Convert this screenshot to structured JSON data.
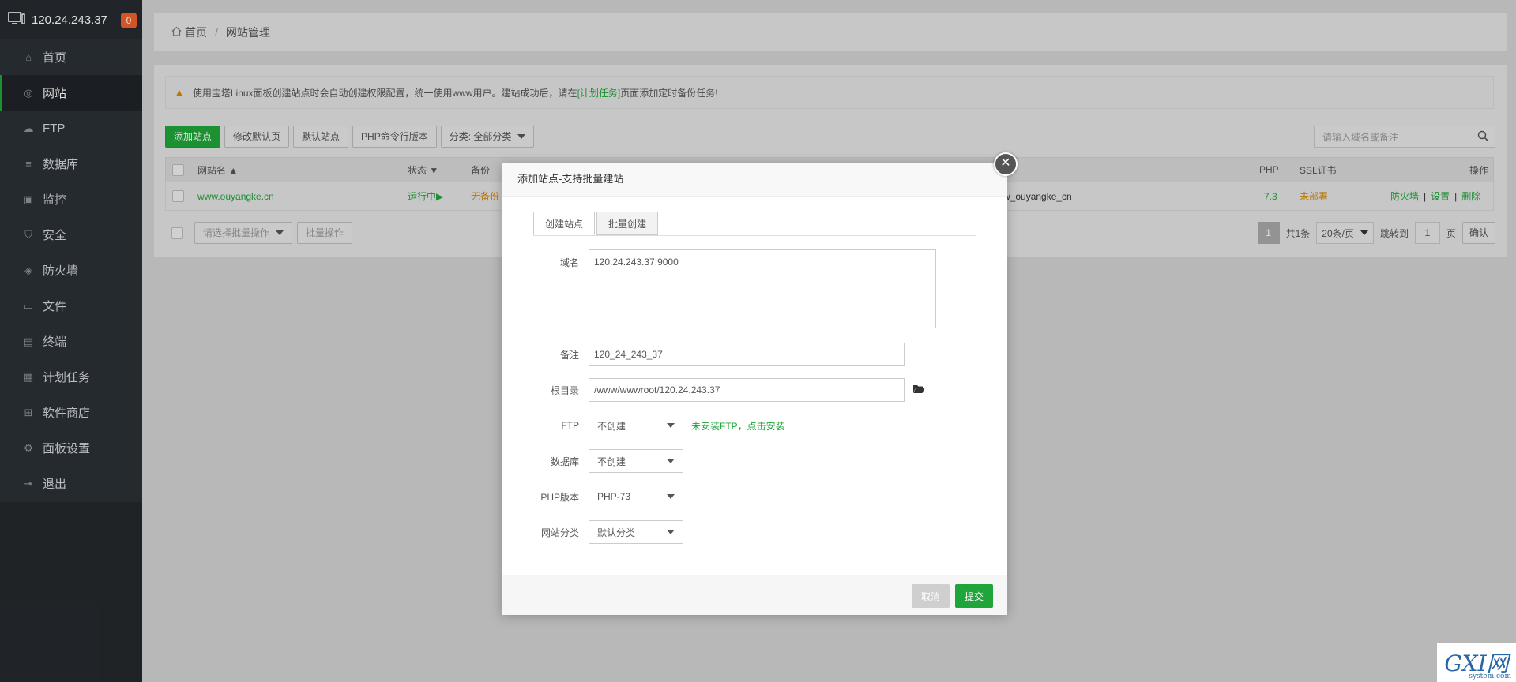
{
  "sidebar": {
    "host": "120.24.243.37",
    "badge": "0",
    "items": [
      {
        "label": "首页",
        "icon": "home-icon"
      },
      {
        "label": "网站",
        "icon": "globe-icon",
        "active": true
      },
      {
        "label": "FTP",
        "icon": "cloud-icon"
      },
      {
        "label": "数据库",
        "icon": "database-icon"
      },
      {
        "label": "监控",
        "icon": "monitor-icon"
      },
      {
        "label": "安全",
        "icon": "shield-icon"
      },
      {
        "label": "防火墙",
        "icon": "firewall-icon"
      },
      {
        "label": "文件",
        "icon": "folder-icon"
      },
      {
        "label": "终端",
        "icon": "terminal-icon"
      },
      {
        "label": "计划任务",
        "icon": "calendar-icon"
      },
      {
        "label": "软件商店",
        "icon": "grid-icon"
      },
      {
        "label": "面板设置",
        "icon": "gear-icon"
      },
      {
        "label": "退出",
        "icon": "logout-icon"
      }
    ]
  },
  "breadcrumb": {
    "home": "首页",
    "sep": "/",
    "current": "网站管理"
  },
  "notice": {
    "text_before": "使用宝塔Linux面板创建站点时会自动创建权限配置，统一使用www用户。建站成功后，请在",
    "link": "[计划任务]",
    "text_after": "页面添加定时备份任务!"
  },
  "toolbar": {
    "add": "添加站点",
    "modify_default": "修改默认页",
    "default_site": "默认站点",
    "php_cli": "PHP命令行版本",
    "category": "分类: 全部分类",
    "search_placeholder": "请输入域名或备注"
  },
  "table": {
    "headers": {
      "name": "网站名 ▲",
      "status": "状态 ▼",
      "backup": "备份",
      "php": "PHP",
      "ssl": "SSL证书",
      "ops": "操作"
    },
    "row": {
      "name": "www.ouyangke.cn",
      "status": "运行中▶",
      "backup": "无备份",
      "remark": "w_ouyangke_cn",
      "php": "7.3",
      "ssl": "未部署",
      "op_firewall": "防火墙",
      "op_settings": "设置",
      "op_delete": "删除",
      "op_sep": "|"
    }
  },
  "batch": {
    "select_placeholder": "请选择批量操作",
    "button": "批量操作"
  },
  "pager": {
    "current": "1",
    "total": "共1条",
    "per_page": "20条/页",
    "jump_label": "跳转到",
    "jump_value": "1",
    "page_unit": "页",
    "confirm": "确认"
  },
  "modal": {
    "title": "添加站点-支持批量建站",
    "tab_create": "创建站点",
    "tab_batch": "批量创建",
    "domain_label": "域名",
    "domain_value": "120.24.243.37:9000",
    "remark_label": "备注",
    "remark_value": "120_24_243_37",
    "root_label": "根目录",
    "root_value": "/www/wwwroot/120.24.243.37",
    "ftp_label": "FTP",
    "ftp_value": "不创建",
    "ftp_hint": "未安装FTP，点击安装",
    "db_label": "数据库",
    "db_value": "不创建",
    "php_label": "PHP版本",
    "php_value": "PHP-73",
    "cat_label": "网站分类",
    "cat_value": "默认分类",
    "cancel": "取消",
    "submit": "提交"
  },
  "watermark": {
    "logo": "GXI网",
    "sub": "system.com"
  }
}
